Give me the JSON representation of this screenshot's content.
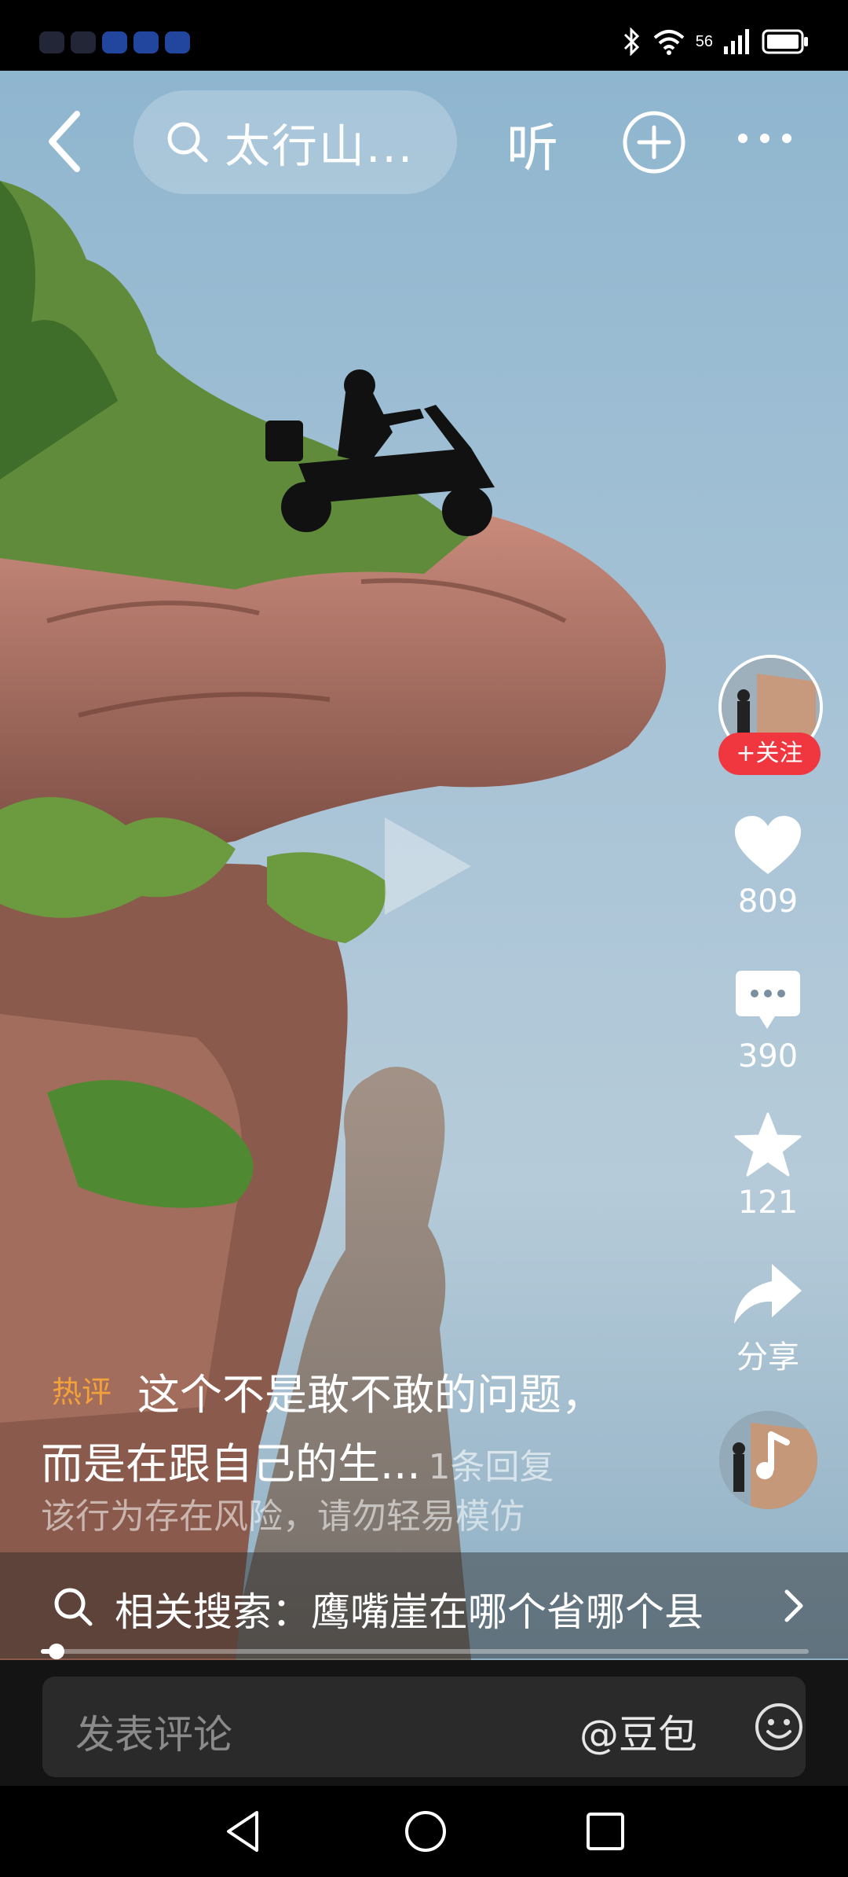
{
  "status_bar": {
    "network": "56",
    "icons": [
      "bluetooth-icon",
      "wifi-icon",
      "signal-icon",
      "battery-icon"
    ]
  },
  "toolbar": {
    "search_text": "太行山...",
    "listen_label": "听"
  },
  "author": {
    "follow_label": "+关注"
  },
  "actions": {
    "like_count": "809",
    "comment_count": "390",
    "favorite_count": "121",
    "share_label": "分享"
  },
  "caption": {
    "hot_tag": "热评",
    "line1": "这个不是敢不敢的问题，",
    "line2": "而是在跟自己的生...",
    "reply_count": "1条回复",
    "risk_notice": "该行为存在风险，请勿轻易模仿"
  },
  "related_search": {
    "text": "相关搜索：鹰嘴崖在哪个省哪个县"
  },
  "progress": {
    "fraction": 0.02
  },
  "comment_bar": {
    "placeholder": "发表评论",
    "mention": "@豆包"
  },
  "colors": {
    "follow": "#f0363f",
    "hot_tag": "#f3a23a"
  }
}
